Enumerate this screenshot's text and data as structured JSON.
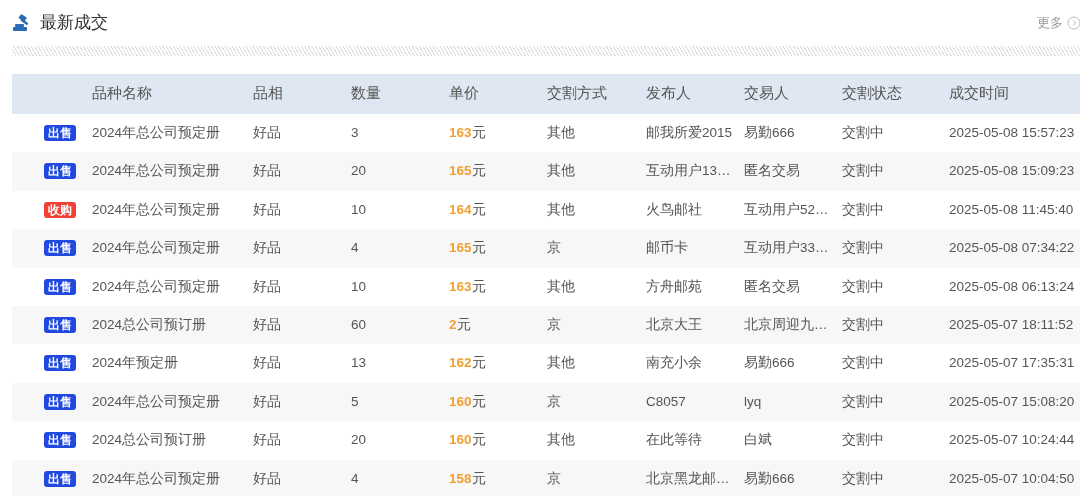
{
  "header": {
    "title": "最新成交",
    "more": "更多"
  },
  "table": {
    "columns": [
      "品种名称",
      "品相",
      "数量",
      "单价",
      "交割方式",
      "发布人",
      "交易人",
      "交割状态",
      "成交时间"
    ],
    "rows": [
      {
        "tag": {
          "kind": "sell",
          "label": "出售"
        },
        "name": "2024年总公司预定册",
        "grade": "好品",
        "qty": "3",
        "price": "**163**元",
        "method": "其他",
        "publisher": "邮我所爱2015",
        "trader": "易勤666",
        "status": "交割中",
        "time": "2025-05-08 15:57:23"
      },
      {
        "tag": {
          "kind": "sell",
          "label": "出售"
        },
        "name": "2024年总公司预定册",
        "grade": "好品",
        "qty": "20",
        "price": "**165**元",
        "method": "其他",
        "publisher": "互动用户13…",
        "trader": "匿名交易",
        "status": "交割中",
        "time": "2025-05-08 15:09:23"
      },
      {
        "tag": {
          "kind": "buy",
          "label": "收购"
        },
        "name": "2024年总公司预定册",
        "grade": "好品",
        "qty": "10",
        "price": "**164**元",
        "method": "其他",
        "publisher": "火鸟邮社",
        "trader": "互动用户52…",
        "status": "交割中",
        "time": "2025-05-08 11:45:40"
      },
      {
        "tag": {
          "kind": "sell",
          "label": "出售"
        },
        "name": "2024年总公司预定册",
        "grade": "好品",
        "qty": "4",
        "price": "**165**元",
        "method": "京",
        "publisher": "邮币卡",
        "trader": "互动用户33…",
        "status": "交割中",
        "time": "2025-05-08 07:34:22"
      },
      {
        "tag": {
          "kind": "sell",
          "label": "出售"
        },
        "name": "2024年总公司预定册",
        "grade": "好品",
        "qty": "10",
        "price": "**163**元",
        "method": "其他",
        "publisher": "方舟邮苑",
        "trader": "匿名交易",
        "status": "交割中",
        "time": "2025-05-08 06:13:24"
      },
      {
        "tag": {
          "kind": "sell",
          "label": "出售"
        },
        "name": "2024总公司预订册",
        "grade": "好品",
        "qty": "60",
        "price": "**2**元",
        "method": "京",
        "publisher": "北京大王",
        "trader": "北京周迎九…",
        "status": "交割中",
        "time": "2025-05-07 18:11:52"
      },
      {
        "tag": {
          "kind": "sell",
          "label": "出售"
        },
        "name": "2024年预定册",
        "grade": "好品",
        "qty": "13",
        "price": "**162**元",
        "method": "其他",
        "publisher": "南充小余",
        "trader": "易勤666",
        "status": "交割中",
        "time": "2025-05-07 17:35:31"
      },
      {
        "tag": {
          "kind": "sell",
          "label": "出售"
        },
        "name": "2024年总公司预定册",
        "grade": "好品",
        "qty": "5",
        "price": "**160**元",
        "method": "京",
        "publisher": "C8057",
        "trader": "lyq",
        "status": "交割中",
        "time": "2025-05-07 15:08:20"
      },
      {
        "tag": {
          "kind": "sell",
          "label": "出售"
        },
        "name": "2024总公司预订册",
        "grade": "好品",
        "qty": "20",
        "price": "**160**元",
        "method": "其他",
        "publisher": "在此等待",
        "trader": "白斌",
        "status": "交割中",
        "time": "2025-05-07 10:24:44"
      },
      {
        "tag": {
          "kind": "sell",
          "label": "出售"
        },
        "name": "2024年总公司预定册",
        "grade": "好品",
        "qty": "4",
        "price": "**158**元",
        "method": "京",
        "publisher": "北京黑龙邮…",
        "trader": "易勤666",
        "status": "交割中",
        "time": "2025-05-07 10:04:50"
      }
    ]
  }
}
